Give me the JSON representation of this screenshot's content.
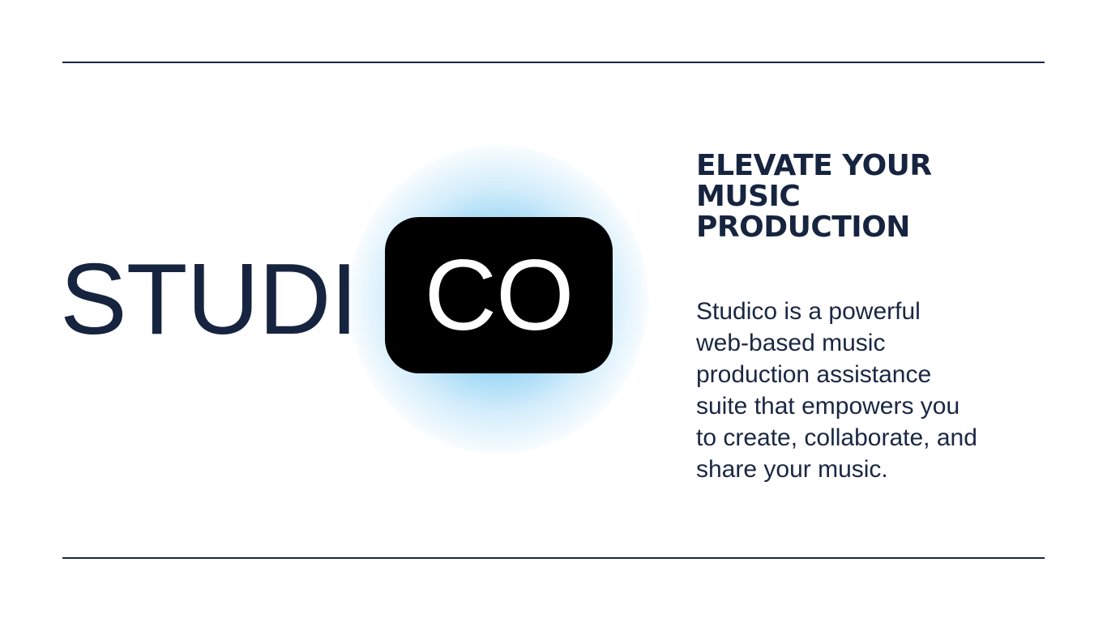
{
  "logo": {
    "part1": "STUDI",
    "part2": "CO"
  },
  "headline": {
    "line1": "ELEVATE YOUR",
    "line2": "MUSIC",
    "line3": "PRODUCTION"
  },
  "description": {
    "line1": "Studico is a powerful",
    "line2": "web-based music",
    "line3": "production assistance",
    "line4": "suite that empowers you",
    "line5": "to create, collaborate, and",
    "line6": "share your music."
  },
  "colors": {
    "text": "#16243f",
    "logo_box": "#000000",
    "glow": "#56b8ee",
    "rule": "#1a2742",
    "background": "#ffffff"
  }
}
